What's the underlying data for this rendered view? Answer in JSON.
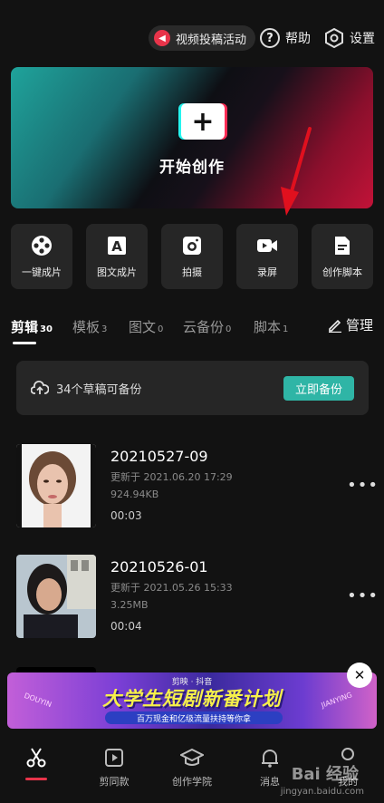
{
  "topbar": {
    "promo_label": "视频投稿活动",
    "help_label": "帮助",
    "settings_label": "设置"
  },
  "hero": {
    "title": "开始创作"
  },
  "tools": [
    {
      "label": "一键成片",
      "icon": "film-reel-icon"
    },
    {
      "label": "图文成片",
      "icon": "text-image-icon"
    },
    {
      "label": "拍摄",
      "icon": "camera-icon"
    },
    {
      "label": "录屏",
      "icon": "video-record-icon"
    },
    {
      "label": "创作脚本",
      "icon": "script-document-icon"
    }
  ],
  "tabs": [
    {
      "label": "剪辑",
      "count": "30"
    },
    {
      "label": "模板",
      "count": "3"
    },
    {
      "label": "图文",
      "count": "0"
    },
    {
      "label": "云备份",
      "count": "0"
    },
    {
      "label": "脚本",
      "count": "1"
    }
  ],
  "manage_label": "管理",
  "backup": {
    "text": "34个草稿可备份",
    "button": "立即备份"
  },
  "drafts": [
    {
      "title": "20210527-09",
      "updated": "更新于 2021.06.20 17:29",
      "size": "924.94KB",
      "duration": "00:03"
    },
    {
      "title": "20210526-01",
      "updated": "更新于 2021.05.26 15:33",
      "size": "3.25MB",
      "duration": "00:04"
    }
  ],
  "ad": {
    "top": "剪映 · 抖音",
    "main": "大学生短剧新番计划",
    "sub": "百万现金和亿级流量扶持等你拿",
    "left": "DOUYIN",
    "right": "JIANYING"
  },
  "nav": [
    {
      "label": "",
      "icon": "scissors-icon"
    },
    {
      "label": "剪同款",
      "icon": "template-play-icon"
    },
    {
      "label": "创作学院",
      "icon": "graduation-cap-icon"
    },
    {
      "label": "消息",
      "icon": "bell-icon"
    },
    {
      "label": "我的",
      "icon": "user-icon"
    }
  ],
  "watermark": {
    "brand": "Bai 经验",
    "url": "jingyan.baidu.com"
  }
}
